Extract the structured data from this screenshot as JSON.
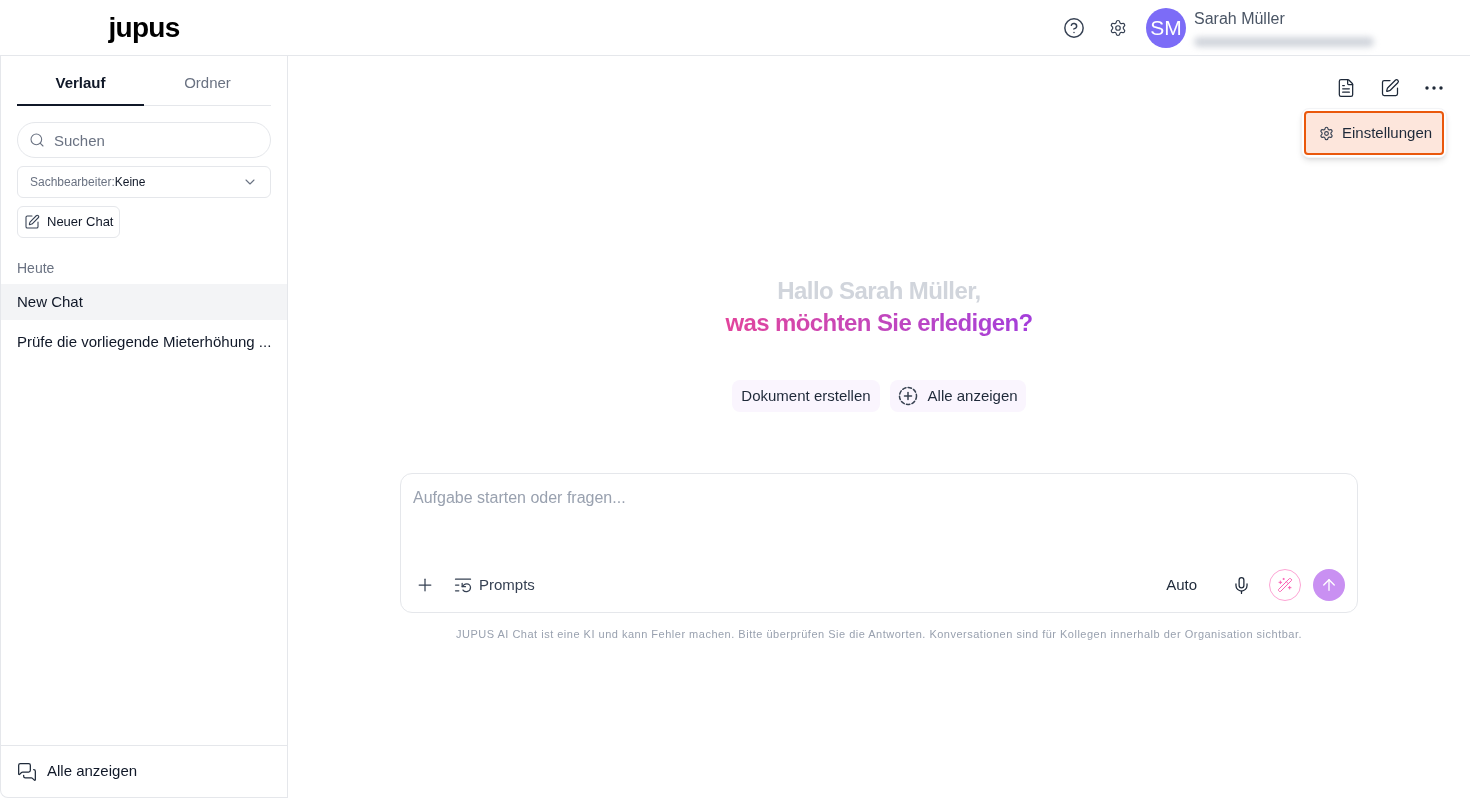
{
  "header": {
    "logo": "jupus",
    "user": {
      "initials": "SM",
      "name": "Sarah Müller"
    }
  },
  "sidebar": {
    "tabs": [
      {
        "label": "Verlauf",
        "selected": true
      },
      {
        "label": "Ordner",
        "selected": false
      }
    ],
    "search": {
      "placeholder": "Suchen"
    },
    "filter": {
      "label": "Sachbearbeiter:",
      "value": "Keine"
    },
    "new_chat_button": "Neuer Chat",
    "groups": [
      {
        "heading": "Heute",
        "items": [
          {
            "title": "New Chat",
            "selected": true
          },
          {
            "title": "Prüfe die vorliegende Mieterhöhung ...",
            "selected": false
          }
        ]
      }
    ],
    "footer_link": "Alle anzeigen"
  },
  "main": {
    "menu": {
      "items": [
        {
          "label": "Einstellungen",
          "selected": true
        }
      ]
    },
    "greeting": {
      "line_1": "Hallo Sarah Müller,",
      "line_2": "was möchten Sie erledigen?"
    },
    "suggestions": [
      {
        "label": "Dokument erstellen",
        "kind": "plain"
      },
      {
        "label": "Alle anzeigen",
        "kind": "more"
      }
    ],
    "composer": {
      "placeholder": "Aufgabe starten oder fragen...",
      "prompts_button": "Prompts",
      "model": "Auto"
    },
    "disclaimer": "JUPUS AI Chat ist eine KI und kann Fehler machen. Bitte überprüfen Sie die Antworten. Konversationen sind für Kollegen innerhalb der Organisation sichtbar."
  }
}
